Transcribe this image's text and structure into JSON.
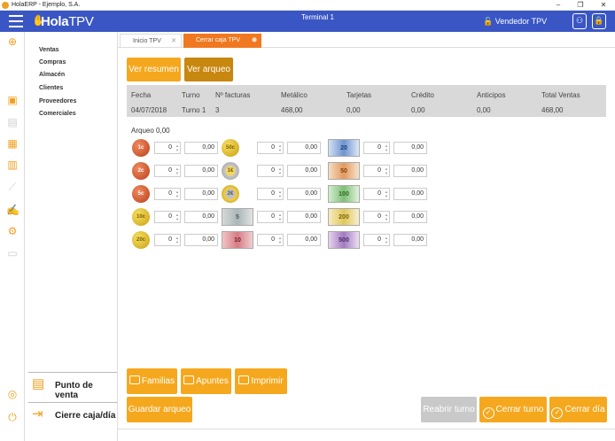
{
  "window": {
    "title": "HolaERP - Ejemplo, S.A.",
    "min": "–",
    "max": "❐",
    "close": "✕"
  },
  "topbar": {
    "logo_hola": "Hola",
    "logo_tpv": "TPV",
    "terminal": "Terminal 1",
    "vendor": "Vendedor TPV"
  },
  "menu": {
    "items": [
      "Ventas",
      "Compras",
      "Almacén",
      "Clientes",
      "Proveedores",
      "Comerciales"
    ],
    "punto_venta": "Punto de venta",
    "cierre": "Cierre caja/día"
  },
  "tabs": [
    {
      "label": "Inicio TPV"
    },
    {
      "label": "Cerrar caja TPV"
    }
  ],
  "actions": {
    "ver_resumen": "Ver resumen",
    "ver_arqueo": "Ver arqueo"
  },
  "summary": {
    "headers": [
      "Fecha",
      "Turno",
      "Nº facturas",
      "Metálico",
      "Tarjetas",
      "Crédito",
      "Anticipos",
      "Total Ventas"
    ],
    "values": [
      "04/07/2018",
      "Turno 1",
      "3",
      "468,00",
      "0,00",
      "0,00",
      "0,00",
      "468,00"
    ]
  },
  "arqueo": {
    "label": "Arqueo 0,00",
    "col1": [
      {
        "face": "1c",
        "count": "0",
        "total": "0,00"
      },
      {
        "face": "2c",
        "count": "0",
        "total": "0,00"
      },
      {
        "face": "5c",
        "count": "0",
        "total": "0,00"
      },
      {
        "face": "10c",
        "count": "0",
        "total": "0,00"
      },
      {
        "face": "20c",
        "count": "0",
        "total": "0,00"
      }
    ],
    "col2": [
      {
        "face": "50c",
        "count": "0",
        "total": "0,00"
      },
      {
        "face": "1€",
        "count": "0",
        "total": "0,00"
      },
      {
        "face": "2€",
        "count": "0",
        "total": "0,00"
      },
      {
        "face": "5",
        "count": "0",
        "total": "0,00"
      },
      {
        "face": "10",
        "count": "0",
        "total": "0,00"
      }
    ],
    "col3": [
      {
        "face": "20",
        "count": "0",
        "total": "0,00"
      },
      {
        "face": "50",
        "count": "0",
        "total": "0,00"
      },
      {
        "face": "100",
        "count": "0",
        "total": "0,00"
      },
      {
        "face": "200",
        "count": "0",
        "total": "0,00"
      },
      {
        "face": "500",
        "count": "0",
        "total": "0,00"
      }
    ]
  },
  "footer": {
    "familias": "Familias",
    "apuntes": "Apuntes",
    "imprimir": "Imprimir",
    "guardar": "Guardar arqueo",
    "reabrir": "Reabrir turno",
    "cerrar_turno": "Cerrar turno",
    "cerrar_dia": "Cerrar día"
  },
  "colors": {
    "topbar": "#3a56c4",
    "accent": "#f5a81e",
    "tab_active": "#f07820"
  }
}
